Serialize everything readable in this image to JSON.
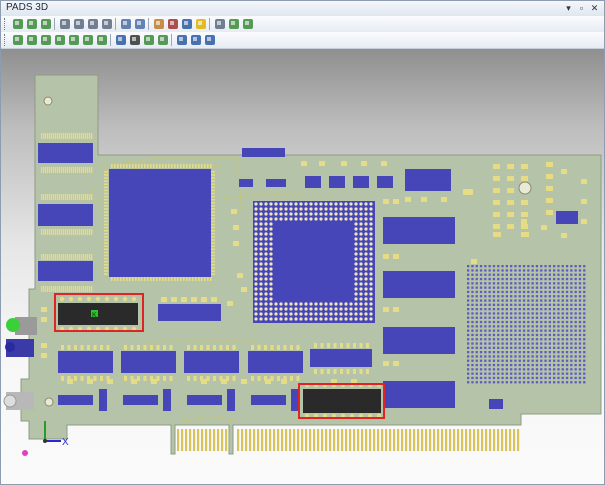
{
  "window": {
    "title": "PADS 3D",
    "controls": {
      "pin": "▾",
      "restore": "▫",
      "close": "✕"
    }
  },
  "toolbar_1": {
    "buttons": [
      {
        "name": "open-icon",
        "color": "#3a8a3a"
      },
      {
        "name": "import-icon",
        "color": "#3a8a3a"
      },
      {
        "name": "export-icon",
        "color": "#3a8a3a"
      },
      {
        "name": "print-icon",
        "color": "#5a6a80"
      },
      {
        "name": "print-preview-icon",
        "color": "#5a6a80"
      },
      {
        "name": "save-image-icon",
        "color": "#5a6a80"
      },
      {
        "name": "copy-icon",
        "color": "#5a6a80"
      },
      {
        "name": "zoom-icon",
        "color": "#4a6fa5"
      },
      {
        "name": "binoculars-icon",
        "color": "#4a6fa5"
      },
      {
        "name": "measure-icon",
        "color": "#c07a2a"
      },
      {
        "name": "clearance-icon",
        "color": "#a03030"
      },
      {
        "name": "collision-icon",
        "color": "#2a5aa0"
      },
      {
        "name": "warning-icon",
        "color": "#e0b000"
      },
      {
        "name": "settings-icon",
        "color": "#5a6a80"
      },
      {
        "name": "layers-icon",
        "color": "#3a8a3a"
      },
      {
        "name": "options-icon",
        "color": "#3a8a3a"
      }
    ]
  },
  "toolbar_2": {
    "buttons": [
      {
        "name": "view-iso-icon",
        "color": "#3a8a3a"
      },
      {
        "name": "view-top-icon",
        "color": "#3a8a3a"
      },
      {
        "name": "view-bottom-icon",
        "color": "#3a8a3a"
      },
      {
        "name": "view-front-icon",
        "color": "#3a8a3a"
      },
      {
        "name": "view-back-icon",
        "color": "#3a8a3a"
      },
      {
        "name": "view-left-icon",
        "color": "#3a8a3a"
      },
      {
        "name": "view-right-icon",
        "color": "#3a8a3a"
      },
      {
        "name": "fit-view-icon",
        "color": "#2a5aa0"
      },
      {
        "name": "select-cursor-icon",
        "color": "#333333"
      },
      {
        "name": "pan-icon",
        "color": "#3a8a3a"
      },
      {
        "name": "rotate-icon",
        "color": "#3a8a3a"
      },
      {
        "name": "flag-toggle-icon",
        "color": "#2a5aa0"
      },
      {
        "name": "flag-next-icon",
        "color": "#2a5aa0"
      },
      {
        "name": "flag-prev-icon",
        "color": "#2a5aa0"
      }
    ]
  },
  "board": {
    "substrate_color": "#b5c3a8",
    "copper_color": "#c8c57a",
    "pad_color": "#e7dc86",
    "component_color": "#4646b8",
    "highlight_color": "#e02424",
    "marker_label": "K"
  },
  "axis_triad": {
    "x_label": "X",
    "y_label": "Y",
    "z_label": "Z"
  }
}
